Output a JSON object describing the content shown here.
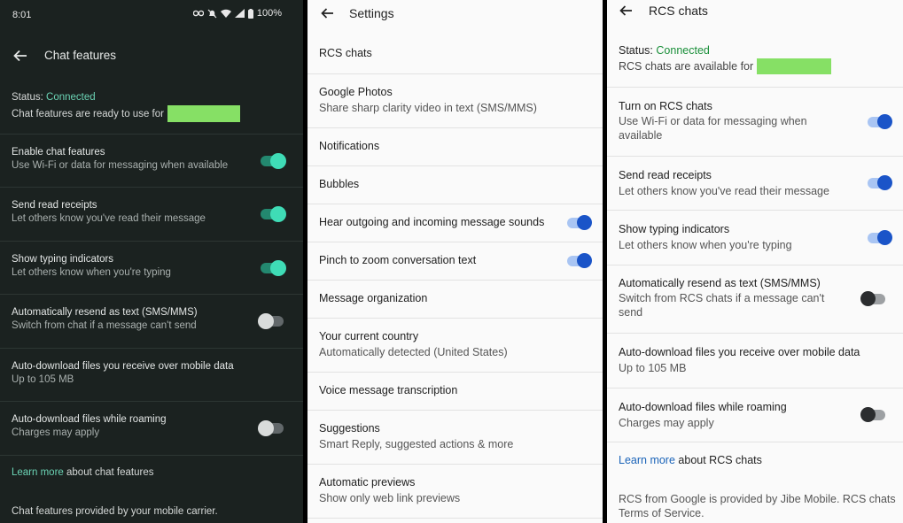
{
  "status_bar": {
    "time": "8:01",
    "battery": "100%"
  },
  "chat_features": {
    "title": "Chat features",
    "status_label": "Status:",
    "status_value": "Connected",
    "ready_text": "Chat features are ready to use for",
    "rows": [
      {
        "title": "Enable chat features",
        "subtitle": "Use Wi-Fi or data for messaging when available",
        "toggle": "on"
      },
      {
        "title": "Send read receipts",
        "subtitle": "Let others know you've read their message",
        "toggle": "on"
      },
      {
        "title": "Show typing indicators",
        "subtitle": "Let others know when you're typing",
        "toggle": "on"
      },
      {
        "title": "Automatically resend as text (SMS/MMS)",
        "subtitle": "Switch from chat if a message can't send",
        "toggle": "off"
      },
      {
        "title": "Auto-download files you receive over mobile data",
        "subtitle": "Up to 105 MB"
      },
      {
        "title": "Auto-download files while roaming",
        "subtitle": "Charges may apply",
        "toggle": "off"
      }
    ],
    "learn_more_link": "Learn more",
    "learn_more_rest": " about chat features",
    "footer": "Chat features provided by your mobile carrier."
  },
  "settings": {
    "title": "Settings",
    "rows": [
      {
        "title": "RCS chats"
      },
      {
        "title": "Google Photos",
        "subtitle": "Share sharp clarity video in text (SMS/MMS)"
      },
      {
        "title": "Notifications"
      },
      {
        "title": "Bubbles"
      },
      {
        "title": "Hear outgoing and incoming message sounds",
        "toggle": "on"
      },
      {
        "title": "Pinch to zoom conversation text",
        "toggle": "on"
      },
      {
        "title": "Message organization"
      },
      {
        "title": "Your current country",
        "subtitle": "Automatically detected (United States)"
      },
      {
        "title": "Voice message transcription"
      },
      {
        "title": "Suggestions",
        "subtitle": "Smart Reply, suggested actions & more"
      },
      {
        "title": "Automatic previews",
        "subtitle": "Show only web link previews"
      }
    ]
  },
  "rcs_chats": {
    "title": "RCS chats",
    "status_label": "Status:",
    "status_value": "Connected",
    "available_text": "RCS chats are available for",
    "rows": [
      {
        "title": "Turn on RCS chats",
        "subtitle": "Use Wi-Fi or data for messaging when available",
        "toggle": "on"
      },
      {
        "title": "Send read receipts",
        "subtitle": "Let others know you've read their message",
        "toggle": "on"
      },
      {
        "title": "Show typing indicators",
        "subtitle": "Let others know when you're typing",
        "toggle": "on"
      },
      {
        "title": "Automatically resend as text (SMS/MMS)",
        "subtitle": "Switch from RCS chats if a message can't send",
        "toggle": "off"
      },
      {
        "title": "Auto-download files you receive over mobile data",
        "subtitle": "Up to 105 MB"
      },
      {
        "title": "Auto-download files while roaming",
        "subtitle": "Charges may apply",
        "toggle": "off"
      }
    ],
    "learn_more_link": "Learn more",
    "learn_more_rest": " about RCS chats",
    "footer": "RCS from Google is provided by Jibe Mobile. RCS chats Terms of Service."
  }
}
